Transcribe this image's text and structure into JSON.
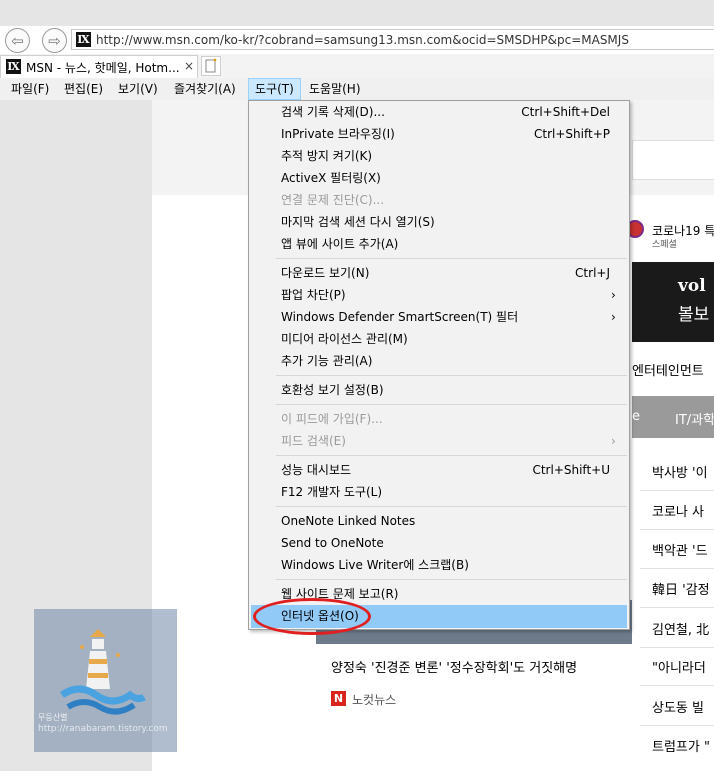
{
  "browser": {
    "url": "http://www.msn.com/ko-kr/?cobrand=samsung13.msn.com&ocid=SMSDHP&pc=MASMJS",
    "tab_title": "MSN - 뉴스, 핫메일, Hotm...",
    "tab_close": "×"
  },
  "menubar": {
    "items": [
      "파일(F)",
      "편집(E)",
      "보기(V)",
      "즐겨찾기(A)",
      "도구(T)",
      "도움말(H)"
    ],
    "active_index": 4
  },
  "tools_menu": {
    "items": [
      {
        "label": "검색 기록 삭제(D)...",
        "shortcut": "Ctrl+Shift+Del"
      },
      {
        "label": "InPrivate 브라우징(I)",
        "shortcut": "Ctrl+Shift+P"
      },
      {
        "label": "추적 방지 켜기(K)"
      },
      {
        "label": "ActiveX 필터링(X)"
      },
      {
        "label": "연결 문제 진단(C)...",
        "disabled": true
      },
      {
        "label": "마지막 검색 세션 다시 열기(S)"
      },
      {
        "label": "앱 뷰에 사이트 추가(A)"
      },
      {
        "label": "다운로드 보기(N)",
        "shortcut": "Ctrl+J"
      },
      {
        "label": "팝업 차단(P)",
        "submenu": true
      },
      {
        "label": "Windows Defender SmartScreen(T) 필터",
        "submenu": true
      },
      {
        "label": "미디어 라이선스 관리(M)"
      },
      {
        "label": "추가 기능 관리(A)"
      },
      {
        "label": "호환성 보기 설정(B)"
      },
      {
        "label": "이 피드에 가입(F)...",
        "disabled": true
      },
      {
        "label": "피드 검색(E)",
        "disabled": true,
        "submenu": true
      },
      {
        "label": "성능 대시보드",
        "shortcut": "Ctrl+Shift+U"
      },
      {
        "label": "F12 개발자 도구(L)"
      },
      {
        "label": "OneNote Linked Notes"
      },
      {
        "label": "Send to OneNote"
      },
      {
        "label": "Windows Live Writer에 스크랩(B)"
      },
      {
        "label": "웹 사이트 문제 보고(R)"
      },
      {
        "label": "인터넷 옵션(O)",
        "highlighted": true
      }
    ],
    "submenu_arrow": "›"
  },
  "page": {
    "corona_label": "코로나19 특",
    "corona_source": "스페셜",
    "banner_line1": "vol",
    "banner_line2": "볼보",
    "entertainment_tab": "엔터테인먼트",
    "nav_tab_1": "e",
    "nav_tab_2": "IT/과학",
    "right_news": [
      "박사방 '이",
      "코로나 사",
      "백악관 '드",
      "韓日 '감정",
      "김연철, 北",
      "\"아니라더",
      "상도동 빌",
      "트럼프가 \""
    ],
    "main_headline": "양정숙 '진경준 변론' '정수장학회'도 거짓해명",
    "source_name": "노컷뉴스",
    "source_icon": "N"
  },
  "watermark": {
    "line1": "무등산별",
    "line2": "http://ranabaram.tistory.com"
  },
  "colors": {
    "highlight": "#91c9f7",
    "annotation": "#e02020",
    "menu_active": "#cce8ff"
  }
}
